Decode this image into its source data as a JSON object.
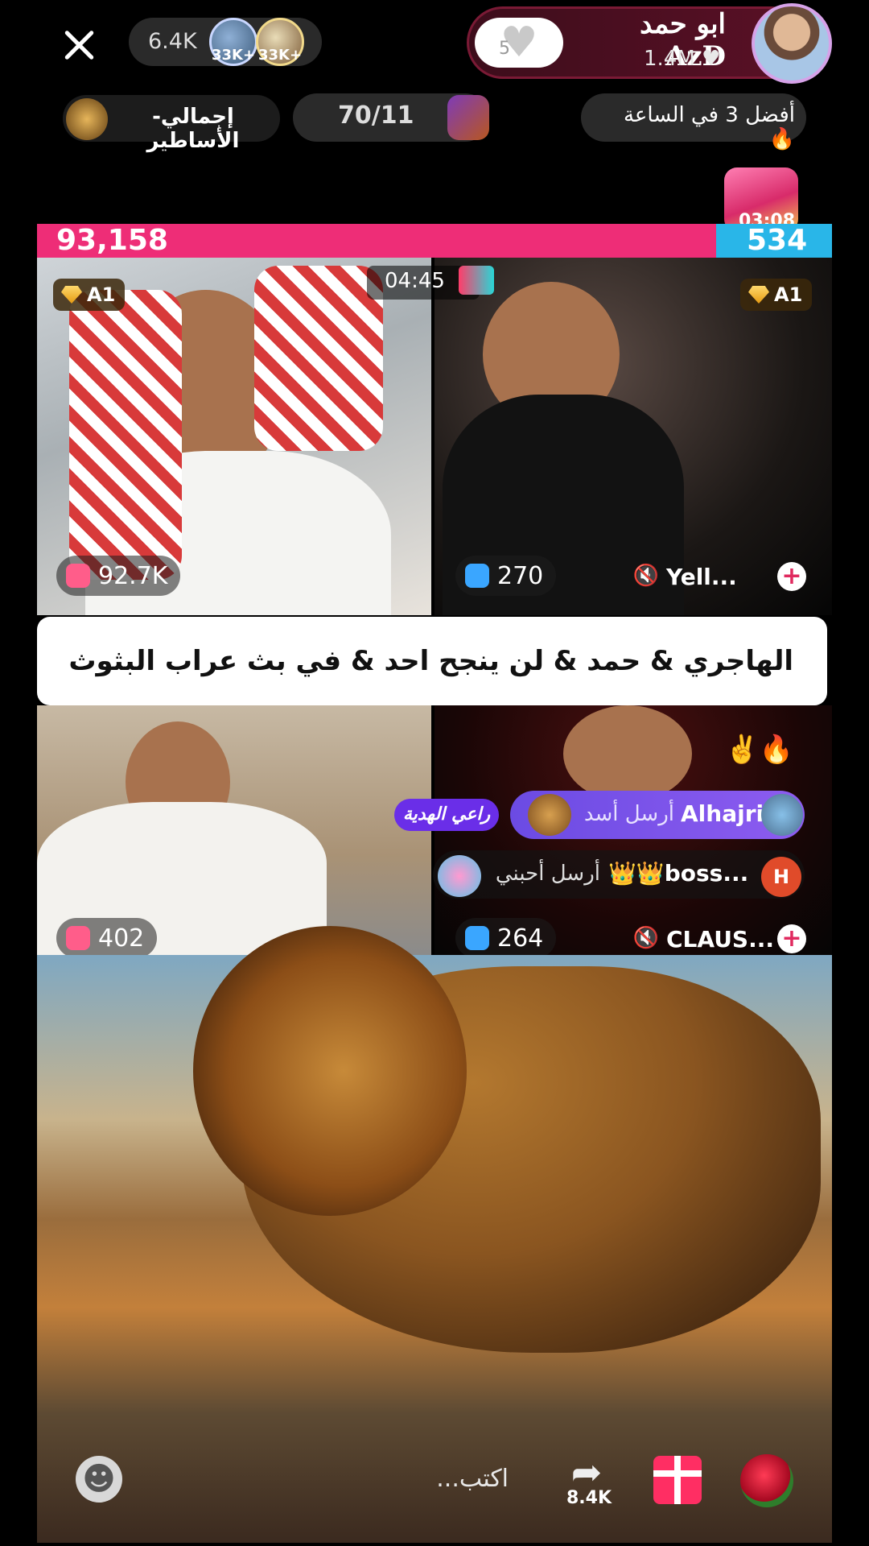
{
  "top_bar": {
    "viewer_count": "6.4K",
    "top_viewers": [
      {
        "badge": "33K+"
      },
      {
        "badge": "33K+"
      }
    ],
    "host_name": "ابو حمد AzD",
    "host_likes": "1.4M",
    "follow_count": "5"
  },
  "second_row": {
    "legends_label": "إجمالي-الأساطير",
    "rank_label": "70/11",
    "top3_label": "أفضل 3 في الساعة"
  },
  "chest_timer": "03:08",
  "battle": {
    "score_left": "93,158",
    "score_right": "534",
    "timer": "04:45",
    "tiles": [
      {
        "badge": "A1",
        "count": "92.7K"
      },
      {
        "badge": "A1",
        "count": "270",
        "user": "Yell..."
      },
      {
        "count": "402"
      },
      {
        "count": "264",
        "user": "CLAUS..."
      }
    ]
  },
  "banner_text": "الهاجري & حمد & لن ينجح احد & في بث عراب البثوث🔥✌️",
  "gifts": [
    {
      "user": "Alhajri",
      "message": "أرسل أسد",
      "tag": "راعي الهدية"
    },
    {
      "user": "👑👑boss...",
      "message": "أرسل أحبني",
      "avatar": "H"
    }
  ],
  "bottom_bar": {
    "comment_placeholder": "اكتب...",
    "share_count": "8.4K"
  }
}
